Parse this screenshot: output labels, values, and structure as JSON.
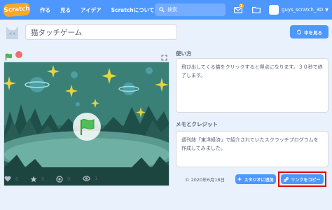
{
  "nav": {
    "logo_text": "Scratch",
    "links": [
      "作る",
      "見る",
      "アイデア",
      "Scratchについて"
    ],
    "search_placeholder": "検索",
    "message_count": "1",
    "username": "guys_scratch_3D"
  },
  "project": {
    "title": "猫タッチゲーム",
    "see_inside_label": "中を見る"
  },
  "instructions": {
    "heading": "使い方",
    "text": "飛び出してくる猫をクリックすると得点になります。３０秒で終了します。"
  },
  "notes": {
    "heading": "メモとクレジット",
    "text": "週刊誌「東洋経済」で紹介されていたスクラッチプログラムを作成してみました。"
  },
  "stats": {
    "loves": "0",
    "favorites": "0",
    "remixes": "0",
    "views": "1"
  },
  "date": "© 2020年6月18日",
  "buttons": {
    "add_to_studio": "スタジオに追加",
    "copy_link": "リンクをコピー"
  },
  "colors": {
    "nav_blue": "#4d97ff",
    "background": "#e9f1fc",
    "highlight_red": "#e00000"
  }
}
